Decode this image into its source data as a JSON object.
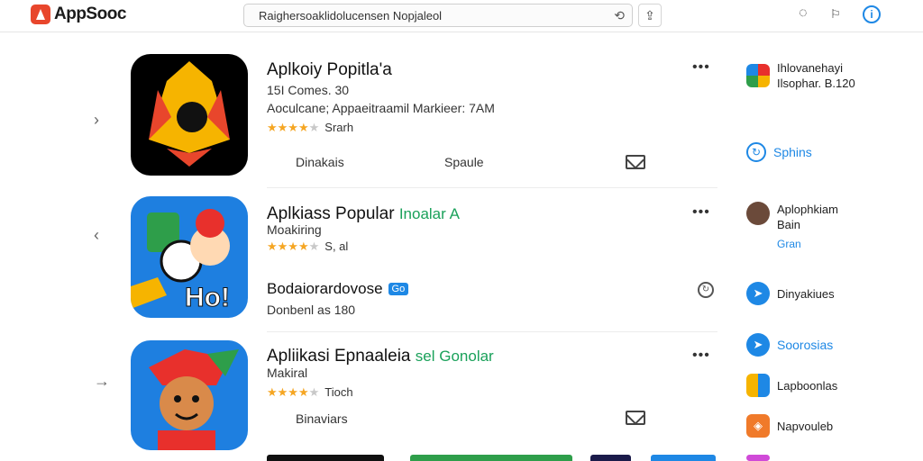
{
  "header": {
    "brand": "AppSooc",
    "search_text": "Raighersoaklidolucensen Nopjaleol",
    "share_icon": "share-icon",
    "icons": [
      "chat-icon",
      "flag-icon",
      "info-icon"
    ]
  },
  "apps": [
    {
      "title": "Aplkoiy Popitla'a",
      "tag": "",
      "line1": "15I Comes. 30",
      "line2": "Aoculcane; Appaeitraamil Markieer: 7AM",
      "stars": "★★★★",
      "rating_count": "Srarh",
      "action_left": "Dinakais",
      "action_mid": "Spaule"
    },
    {
      "title": "Aplkiass Popular",
      "tag": "Inoalar A",
      "line1": "Moakiring",
      "stars": "★★★★",
      "rating_count": "S, al",
      "promo": "Bodaiorardovose",
      "badge": "Go",
      "promo_sub": "Donbenl as 180"
    },
    {
      "title": "Apliikasi Epnaaleia",
      "tag": "sel Gonolar",
      "line1": "Makiral",
      "stars": "★★★★",
      "rating_count": "Tioch",
      "action_left": "Binaviars"
    }
  ],
  "sidebar": [
    {
      "line1": "Ihlovanehayi",
      "line2": "Ilsophar. B.120"
    },
    {
      "label": "Sphins"
    },
    {
      "line1": "Aplophkiam",
      "line2": "Bain",
      "line3": "Gran"
    },
    {
      "label": "Dinyakiues"
    },
    {
      "label": "Soorosias"
    },
    {
      "label": "Lapboonlas"
    },
    {
      "label": "Napvouleb"
    }
  ],
  "colors": {
    "accent": "#1e88e5",
    "brand": "#e8462c",
    "star": "#f5a623",
    "tag_green": "#1aa15a"
  }
}
